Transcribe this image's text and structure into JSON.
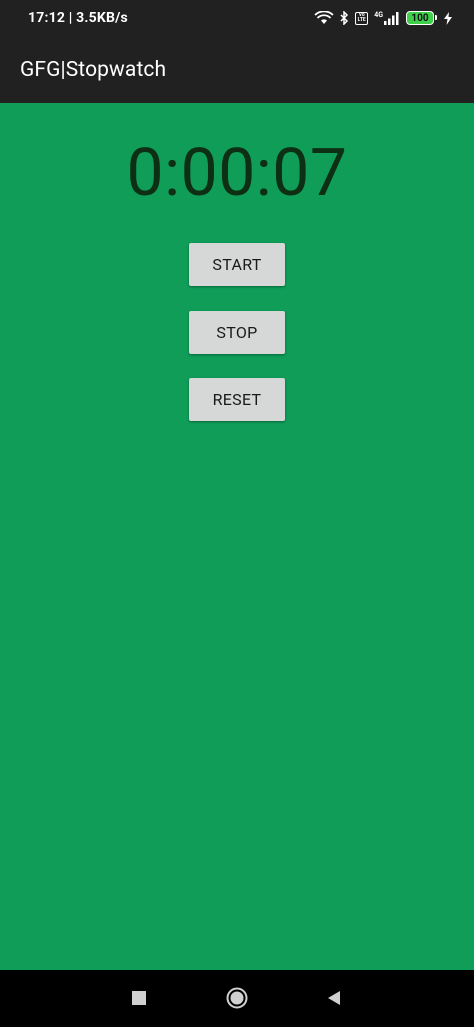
{
  "status_bar": {
    "time_speed": "17:12 | 3.5KB/s",
    "icons": [
      "wifi-icon",
      "bluetooth-icon",
      "volte-icon",
      "signal-4g-icon",
      "battery-icon",
      "charging-icon"
    ],
    "volte_label_top": "Vo",
    "volte_label_bottom": "LTE",
    "network_type": "4G",
    "battery_level": "100"
  },
  "app_bar": {
    "title": "GFG|Stopwatch"
  },
  "stopwatch": {
    "time": "0:00:07",
    "start_label": "START",
    "stop_label": "STOP",
    "reset_label": "RESET"
  },
  "nav_bar": {
    "icons": [
      "recents-icon",
      "home-icon",
      "back-icon"
    ]
  },
  "colors": {
    "background": "#0f9d58",
    "bar": "#212121",
    "button": "#d6d7d7",
    "timer_text": "#0d2f14"
  }
}
